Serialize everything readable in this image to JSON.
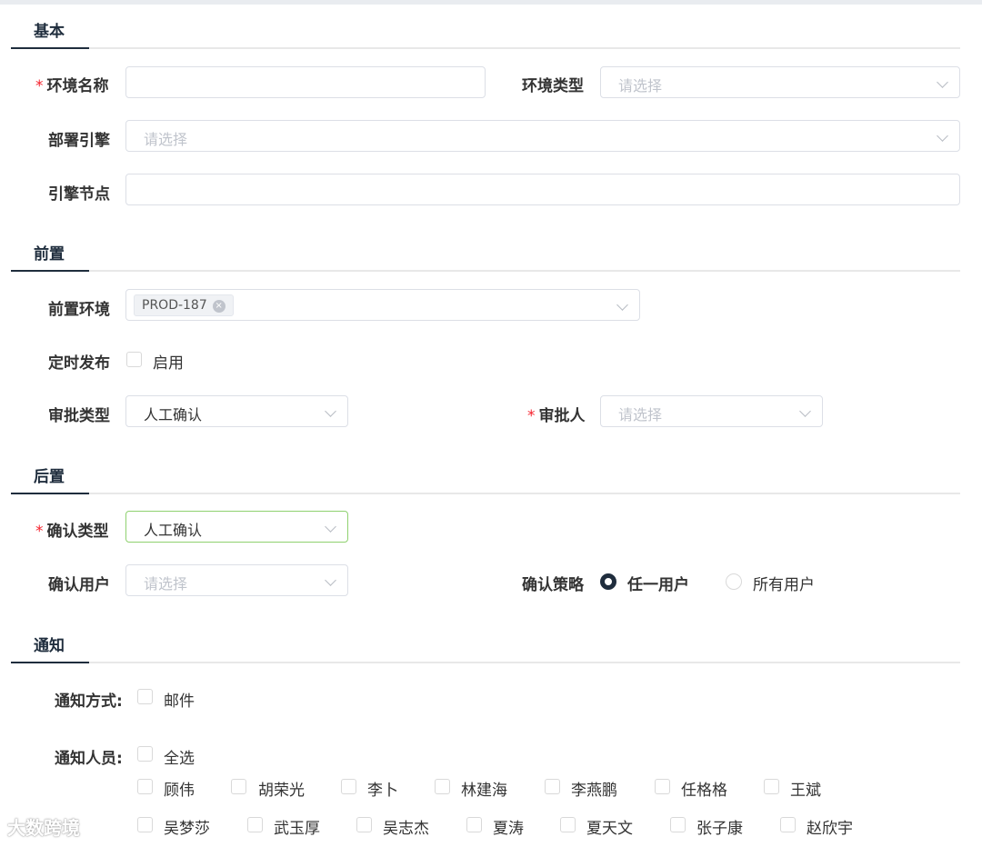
{
  "sections": {
    "basic": "基本",
    "pre": "前置",
    "post": "后置",
    "notify": "通知"
  },
  "required_mark": "*",
  "basic": {
    "env_name_label": "环境名称",
    "env_name_value": "",
    "env_type_label": "环境类型",
    "env_type_placeholder": "请选择",
    "deploy_engine_label": "部署引擎",
    "deploy_engine_placeholder": "请选择",
    "engine_node_label": "引擎节点",
    "engine_node_value": ""
  },
  "pre": {
    "pre_env_label": "前置环境",
    "pre_env_tags": [
      "PROD-187"
    ],
    "tag_remove_icon": "×",
    "scheduled_release_label": "定时发布",
    "enable_label": "启用",
    "approval_type_label": "审批类型",
    "approval_type_value": "人工确认",
    "approver_label": "审批人",
    "approver_placeholder": "请选择"
  },
  "post": {
    "confirm_type_label": "确认类型",
    "confirm_type_value": "人工确认",
    "confirm_user_label": "确认用户",
    "confirm_user_placeholder": "请选择",
    "confirm_strategy_label": "确认策略",
    "strategy_options": [
      "任一用户",
      "所有用户"
    ],
    "strategy_selected": "任一用户"
  },
  "notify": {
    "method_label": "通知方式:",
    "method_options": [
      "邮件"
    ],
    "people_label": "通知人员:",
    "select_all_label": "全选",
    "people_row1": [
      "顾伟",
      "胡荣光",
      "李卜",
      "林建海",
      "李燕鹏",
      "任格格",
      "王斌"
    ],
    "people_row2": [
      "吴梦莎",
      "武玉厚",
      "吴志杰",
      "夏涛",
      "夏天文",
      "张子康",
      "赵欣宇"
    ]
  },
  "watermark": "大数跨境",
  "colors": {
    "accent_dark": "#1f2d3d",
    "required": "#f5222d",
    "focus_border": "#8fd16f"
  }
}
